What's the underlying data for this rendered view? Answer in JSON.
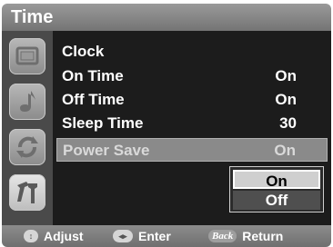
{
  "header": {
    "title": "Time"
  },
  "sidebar": {
    "icons": [
      "picture-icon",
      "sound-icon",
      "setup-icon",
      "tools-icon"
    ]
  },
  "menu": {
    "items": [
      {
        "label": "Clock",
        "value": ""
      },
      {
        "label": "On Time",
        "value": "On"
      },
      {
        "label": "Off Time",
        "value": "On"
      },
      {
        "label": "Sleep Time",
        "value": "30"
      },
      {
        "label": "Power Save",
        "value": "On",
        "selected": true
      }
    ]
  },
  "dropdown": {
    "options": [
      "On",
      "Off"
    ],
    "selected": "On"
  },
  "footer": {
    "adjust_label": "Adjust",
    "enter_label": "Enter",
    "back_key": "Back",
    "return_label": "Return"
  },
  "colors": {
    "header_bg": "#8a8a8a",
    "panel_bg": "#1c1c1c",
    "selected_row_bg": "#8a8a8a",
    "dropdown_selected_bg": "#cfcfcf"
  }
}
